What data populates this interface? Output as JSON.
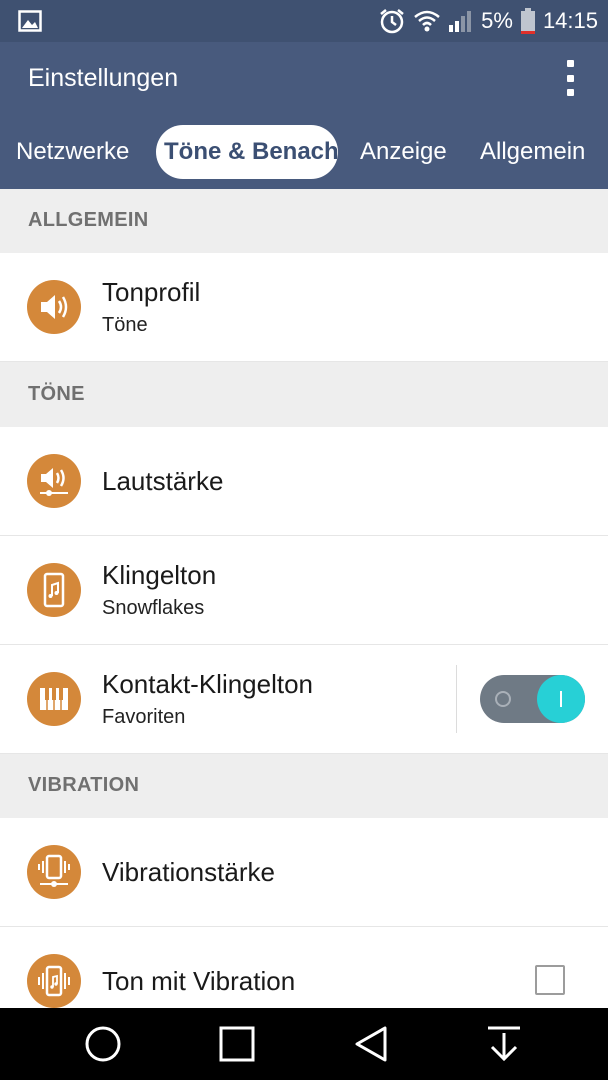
{
  "status_bar": {
    "battery_percent": "5%",
    "time": "14:15",
    "icons": [
      "image-icon",
      "alarm-icon",
      "wifi-icon",
      "signal-icon",
      "battery-icon"
    ]
  },
  "app_bar": {
    "title": "Einstellungen",
    "overflow_icon": "more-vert-icon"
  },
  "tabs": [
    {
      "label": "Netzwerke",
      "active": false
    },
    {
      "label": "Töne & Benachrichtigungen",
      "active": true
    },
    {
      "label": "Anzeige",
      "active": false
    },
    {
      "label": "Allgemein",
      "active": false
    }
  ],
  "sections": [
    {
      "header": "ALLGEMEIN",
      "items": [
        {
          "title": "Tonprofil",
          "subtitle": "Töne",
          "icon": "speaker-icon"
        }
      ]
    },
    {
      "header": "TÖNE",
      "items": [
        {
          "title": "Lautstärke",
          "subtitle": "",
          "icon": "volume-slider-icon"
        },
        {
          "title": "Klingelton",
          "subtitle": "Snowflakes",
          "icon": "phone-music-icon"
        },
        {
          "title": "Kontakt-Klingelton",
          "subtitle": "Favoriten",
          "icon": "piano-icon",
          "toggle_on": true
        }
      ]
    },
    {
      "header": "VIBRATION",
      "items": [
        {
          "title": "Vibrationstärke",
          "subtitle": "",
          "icon": "vibration-slider-icon"
        },
        {
          "title": "Ton mit Vibration",
          "subtitle": "",
          "icon": "vibrate-music-icon",
          "checkbox_checked": false
        }
      ]
    }
  ],
  "nav_bar": {
    "icons": [
      "home-circle-icon",
      "recents-square-icon",
      "back-triangle-icon",
      "download-arrow-icon"
    ]
  },
  "colors": {
    "status_bar": "#3f5171",
    "app_bar": "#485a7d",
    "icon_circle": "#d4883a",
    "toggle_accent": "#27d0d6"
  }
}
